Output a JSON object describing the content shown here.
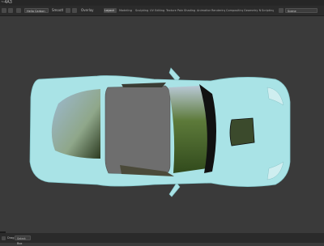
{
  "window": {
    "title": "~4A3"
  },
  "toolbar": {
    "field1": "Hello Carbon",
    "item_mid": "Smooth",
    "field2": "Overlay",
    "tabs": [
      "Layout",
      "Modeling",
      "Sculpting",
      "UV Editing",
      "Texture Paint",
      "Shading",
      "Animation",
      "Rendering",
      "Compositing",
      "Geometry Nodes",
      "Scripting"
    ],
    "active_tab": 0,
    "scene_field": "Scene"
  },
  "status": {
    "left_label": "Drag",
    "field": "Select Box"
  },
  "colors": {
    "car_body": "#a9e3e6",
    "roof": "#6e6e6e",
    "viewport_bg": "#3a3a3a"
  },
  "icons": [
    "editor-type-icon",
    "mode-icon",
    "overlay-icon",
    "scene-icon"
  ]
}
